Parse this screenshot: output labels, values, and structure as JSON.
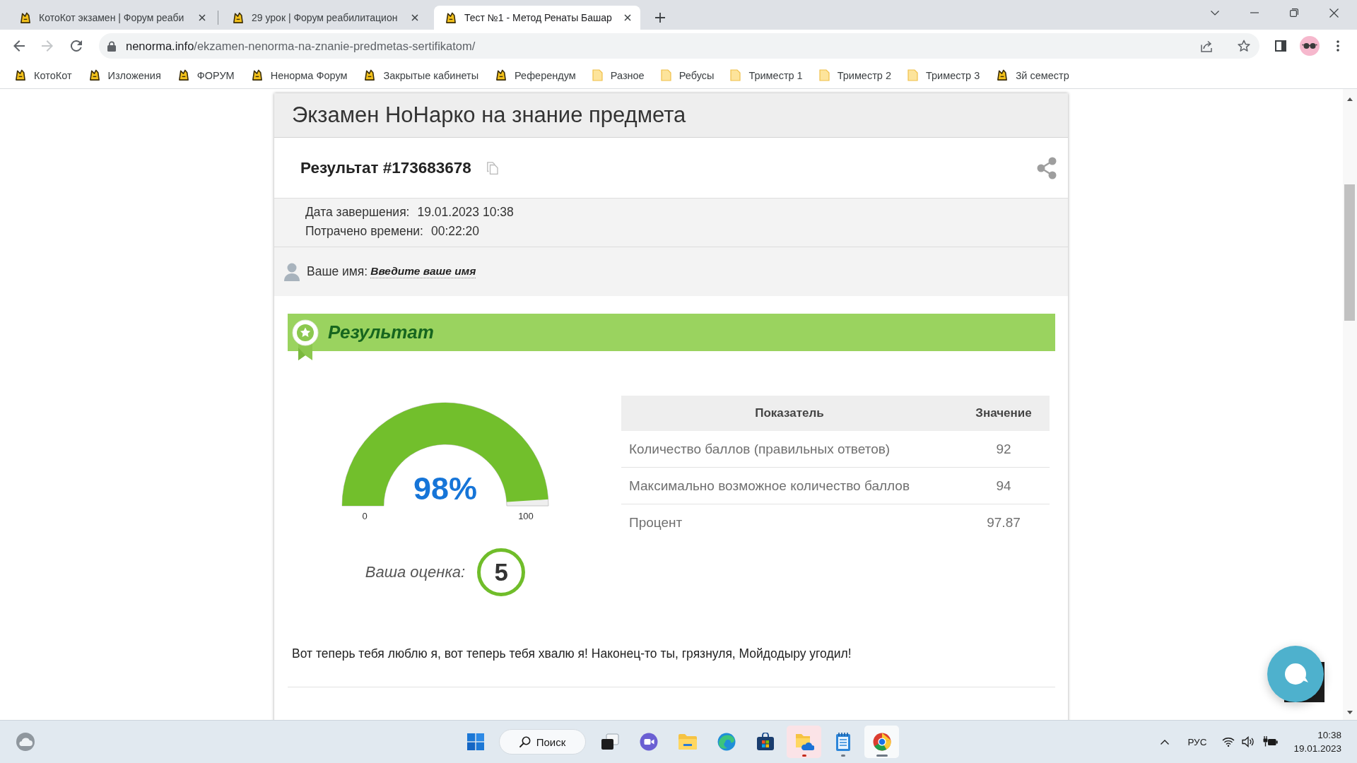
{
  "browser": {
    "tabs": [
      {
        "title": "КотоКот экзамен | Форум реаби",
        "selected": false
      },
      {
        "title": "29 урок | Форум реабилитацион",
        "selected": false
      },
      {
        "title": "Тест №1 - Метод Ренаты Башар",
        "selected": true
      }
    ],
    "forward": {
      "disabled": true
    },
    "address": {
      "host": "nenorma.info",
      "path": "/ekzamen-nenorma-na-znanie-predmetas-sertifikatom/"
    },
    "bookmarks": [
      {
        "label": "КотоКот",
        "kind": "site"
      },
      {
        "label": "Изложения",
        "kind": "site"
      },
      {
        "label": "ФОРУМ",
        "kind": "site"
      },
      {
        "label": "Ненорма Форум",
        "kind": "site"
      },
      {
        "label": "Закрытые кабинеты",
        "kind": "site"
      },
      {
        "label": "Референдум",
        "kind": "site"
      },
      {
        "label": "Разное",
        "kind": "folder"
      },
      {
        "label": "Ребусы",
        "kind": "folder"
      },
      {
        "label": "Триместр 1",
        "kind": "folder"
      },
      {
        "label": "Триместр 2",
        "kind": "folder"
      },
      {
        "label": "Триместр 3",
        "kind": "folder"
      },
      {
        "label": "3й семестр",
        "kind": "site"
      }
    ]
  },
  "page": {
    "title": "Экзамен НоНарко на знание предмета",
    "result": "Результат #173683678",
    "meta": [
      {
        "label": "Дата завершения:",
        "value": "19.01.2023 10:38"
      },
      {
        "label": "Потрачено времени:",
        "value": "00:22:20"
      }
    ],
    "name": {
      "label": "Ваше имя:",
      "link": "Введите ваше имя"
    },
    "banner": "Результат",
    "gauge": {
      "level": 0.98,
      "reading": "98%",
      "min_label": "0",
      "max_label": "100"
    },
    "grade": {
      "label": "Ваша оценка:",
      "value": "5"
    },
    "table": {
      "columns": [
        "Показатель",
        "Значение"
      ],
      "rows": [
        [
          "Количество баллов (правильных ответов)",
          "92"
        ],
        [
          "Максимально возможное количество баллов",
          "94"
        ],
        [
          "Процент",
          "97.87"
        ]
      ]
    },
    "message": "Вот теперь тебя люблю я, вот теперь тебя хвалю я! Наконец-то ты, грязнуля, Мойдодыру угодил!"
  },
  "taskbar": {
    "search": "Поиск",
    "apps": [
      {
        "kind": "task-view",
        "running": false,
        "selected": false,
        "attention": false
      },
      {
        "kind": "chat",
        "running": false,
        "selected": false,
        "attention": false
      },
      {
        "kind": "explorer",
        "running": false,
        "selected": false,
        "attention": false
      },
      {
        "kind": "edge",
        "running": false,
        "selected": false,
        "attention": false
      },
      {
        "kind": "store",
        "running": false,
        "selected": false,
        "attention": false
      },
      {
        "kind": "cloud-folder",
        "running": true,
        "selected": false,
        "attention": true
      },
      {
        "kind": "notepad",
        "running": true,
        "selected": false,
        "attention": false
      },
      {
        "kind": "chrome",
        "running": true,
        "selected": true,
        "attention": false
      }
    ],
    "language": "РУС",
    "time": "10:38",
    "date": "19.01.2023"
  }
}
